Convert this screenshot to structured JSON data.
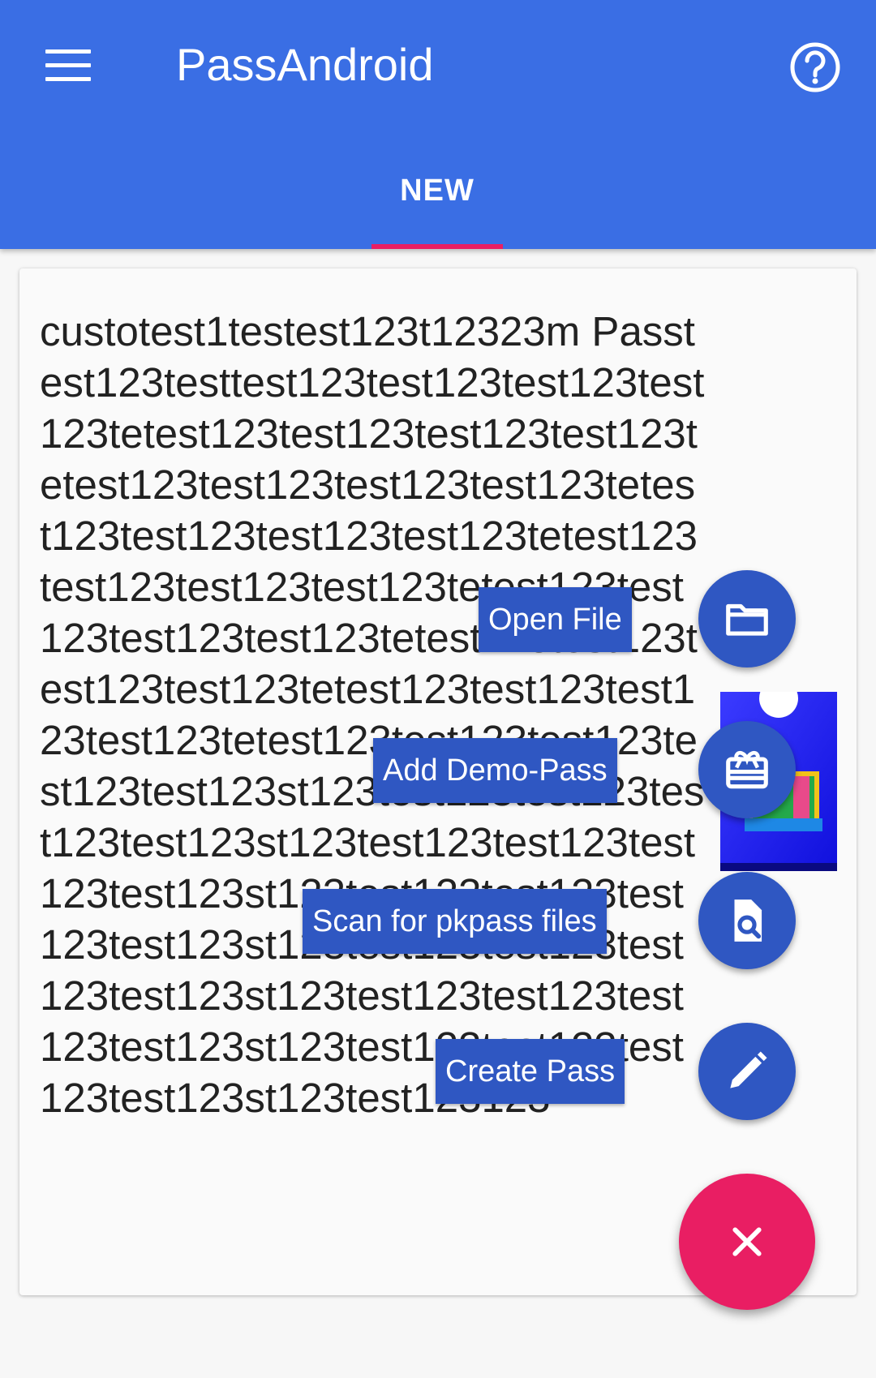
{
  "app": {
    "title": "PassAndroid"
  },
  "toolbar": {
    "menu_icon": "menu-icon",
    "help_icon": "help-circle-icon"
  },
  "tabs": [
    {
      "label": "NEW",
      "selected": true
    }
  ],
  "colors": {
    "primary": "#3a6ee4",
    "accent": "#e91e63",
    "fab_mini": "#2f57c2"
  },
  "card": {
    "text": "custotest1testest123t12323m Passtest123testtest123test123test123test123tetest123test123test123test123tetest123test123test123test123tetest123test123test123test123tetest123test123test123test123tetest123test123test123test123tetest123test123test123test123tetest123test123test123test123tetest123test123test123test123test123st123test123test123test123test123st123test123test123test123test123st123test123test123test123test123st123test123test123test123test123st123test123test123test123test123st123test123test123test123test123st123test123123"
  },
  "fab_menu": {
    "items": [
      {
        "label": "Open File",
        "icon": "folder-icon"
      },
      {
        "label": "Add Demo-Pass",
        "icon": "card-giftcard-icon"
      },
      {
        "label": "Scan for pkpass files",
        "icon": "find-in-page-icon"
      },
      {
        "label": "Create Pass",
        "icon": "pencil-icon"
      }
    ],
    "main_icon": "close-icon"
  }
}
